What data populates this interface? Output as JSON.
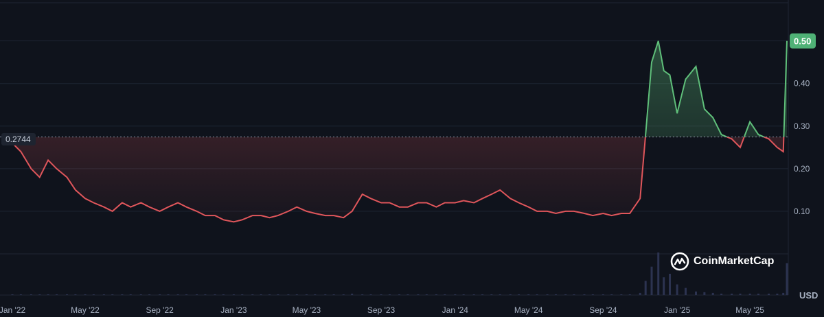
{
  "brand": "CoinMarketCap",
  "currency_label": "USD",
  "reference_label": "0.2744",
  "current_label": "0.50",
  "colors": {
    "background": "#0f131c",
    "up": "#5fbf7a",
    "down": "#e0565b",
    "grid": "#1f2633",
    "volume": "#2c3350",
    "current_badge": "#4fb176"
  },
  "chart_data": {
    "type": "area",
    "x": [
      "2022-01-01",
      "2022-01-15",
      "2022-02-01",
      "2022-02-15",
      "2022-03-01",
      "2022-03-15",
      "2022-04-01",
      "2022-04-15",
      "2022-05-01",
      "2022-05-15",
      "2022-06-01",
      "2022-06-15",
      "2022-07-01",
      "2022-07-15",
      "2022-08-01",
      "2022-08-15",
      "2022-09-01",
      "2022-09-15",
      "2022-10-01",
      "2022-10-15",
      "2022-11-01",
      "2022-11-15",
      "2022-12-01",
      "2022-12-15",
      "2023-01-01",
      "2023-01-15",
      "2023-02-01",
      "2023-02-15",
      "2023-03-01",
      "2023-03-15",
      "2023-04-01",
      "2023-04-15",
      "2023-05-01",
      "2023-05-15",
      "2023-06-01",
      "2023-06-15",
      "2023-07-01",
      "2023-07-15",
      "2023-08-01",
      "2023-08-15",
      "2023-09-01",
      "2023-09-15",
      "2023-10-01",
      "2023-10-15",
      "2023-11-01",
      "2023-11-15",
      "2023-12-01",
      "2023-12-15",
      "2024-01-01",
      "2024-01-15",
      "2024-02-01",
      "2024-02-15",
      "2024-03-01",
      "2024-03-15",
      "2024-04-01",
      "2024-04-15",
      "2024-05-01",
      "2024-05-15",
      "2024-06-01",
      "2024-06-15",
      "2024-07-01",
      "2024-07-15",
      "2024-08-01",
      "2024-08-15",
      "2024-09-01",
      "2024-09-15",
      "2024-10-01",
      "2024-10-15",
      "2024-11-01",
      "2024-11-10",
      "2024-11-20",
      "2024-12-01",
      "2024-12-10",
      "2024-12-20",
      "2025-01-01",
      "2025-01-15",
      "2025-02-01",
      "2025-02-15",
      "2025-03-01",
      "2025-03-15",
      "2025-04-01",
      "2025-04-15",
      "2025-05-01",
      "2025-05-15",
      "2025-06-01",
      "2025-06-15",
      "2025-06-25",
      "2025-07-01"
    ],
    "y": [
      0.26,
      0.24,
      0.2,
      0.18,
      0.22,
      0.2,
      0.18,
      0.15,
      0.13,
      0.12,
      0.11,
      0.1,
      0.12,
      0.11,
      0.12,
      0.11,
      0.1,
      0.11,
      0.12,
      0.11,
      0.1,
      0.09,
      0.09,
      0.08,
      0.075,
      0.08,
      0.09,
      0.09,
      0.085,
      0.09,
      0.1,
      0.11,
      0.1,
      0.095,
      0.09,
      0.09,
      0.085,
      0.1,
      0.14,
      0.13,
      0.12,
      0.12,
      0.11,
      0.11,
      0.12,
      0.12,
      0.11,
      0.12,
      0.12,
      0.125,
      0.12,
      0.13,
      0.14,
      0.15,
      0.13,
      0.12,
      0.11,
      0.1,
      0.1,
      0.095,
      0.1,
      0.1,
      0.095,
      0.09,
      0.095,
      0.09,
      0.095,
      0.095,
      0.13,
      0.28,
      0.45,
      0.5,
      0.43,
      0.42,
      0.33,
      0.41,
      0.44,
      0.34,
      0.32,
      0.28,
      0.27,
      0.25,
      0.31,
      0.28,
      0.27,
      0.25,
      0.24,
      0.5
    ],
    "ylim": [
      0,
      0.58
    ],
    "y_ticks": [
      "0.10",
      "0.20",
      "0.30",
      "0.40",
      "0.50"
    ],
    "x_ticks": [
      "Jan '22",
      "May '22",
      "Sep '22",
      "Jan '23",
      "May '23",
      "Sep '23",
      "Jan '24",
      "May '24",
      "Sep '24",
      "Jan '25",
      "May '25"
    ],
    "x_tick_dates": [
      "2022-01-01",
      "2022-05-01",
      "2022-09-01",
      "2023-01-01",
      "2023-05-01",
      "2023-09-01",
      "2024-01-01",
      "2024-05-01",
      "2024-09-01",
      "2025-01-01",
      "2025-05-01"
    ],
    "baseline": 0.2744,
    "volume": [
      1,
      1,
      1,
      1,
      1,
      1,
      1,
      1,
      1,
      1,
      1,
      1,
      1,
      1,
      1,
      1,
      1,
      1,
      1,
      1,
      1,
      1,
      1,
      1,
      1,
      1,
      1,
      1,
      1,
      1,
      1,
      1,
      1,
      1,
      1,
      1,
      1,
      2,
      1,
      1,
      1,
      1,
      1,
      1,
      1,
      1,
      1,
      1,
      1,
      1,
      1,
      1,
      1,
      1,
      1,
      1,
      1,
      1,
      1,
      1,
      1,
      1,
      1,
      1,
      1,
      1,
      1,
      1,
      3,
      20,
      40,
      60,
      25,
      30,
      15,
      10,
      5,
      4,
      3,
      2,
      2,
      2,
      2,
      2,
      2,
      2,
      3,
      45
    ],
    "grid": true
  }
}
